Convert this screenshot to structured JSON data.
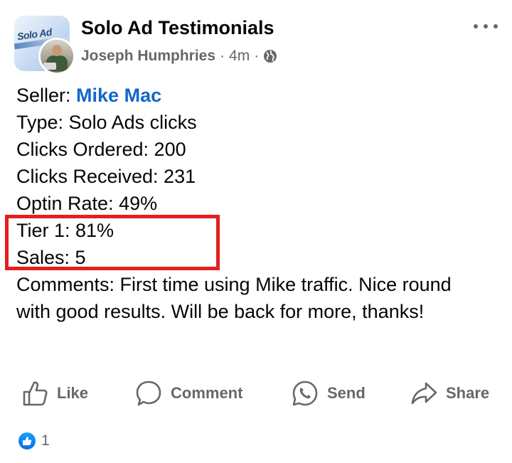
{
  "post": {
    "group_name": "Solo Ad Testimonials",
    "author": "Joseph Humphries",
    "time": "4m",
    "separator": "·",
    "group_image_text": "Solo Ad"
  },
  "content": {
    "seller_label": "Seller: ",
    "seller_name": "Mike Mac",
    "type": "Type: Solo Ads clicks",
    "clicks_ordered": "Clicks Ordered: 200",
    "clicks_received": "Clicks Received: 231",
    "optin_rate": "Optin Rate: 49%",
    "tier1": "Tier 1: 81%",
    "sales": "Sales: 5",
    "comments": "Comments: First time using Mike traffic. Nice round with good results.  Will be back for more, thanks!"
  },
  "actions": {
    "like": "Like",
    "comment": "Comment",
    "send": "Send",
    "share": "Share"
  },
  "reactions": {
    "count": "1"
  },
  "colors": {
    "accent_link": "#1466c9",
    "highlight_box": "#e61e1e",
    "secondary_text": "#65676b"
  },
  "icons": [
    "more-icon",
    "globe-icon",
    "like-icon",
    "comment-icon",
    "whatsapp-icon",
    "share-icon",
    "like-reaction-icon"
  ]
}
